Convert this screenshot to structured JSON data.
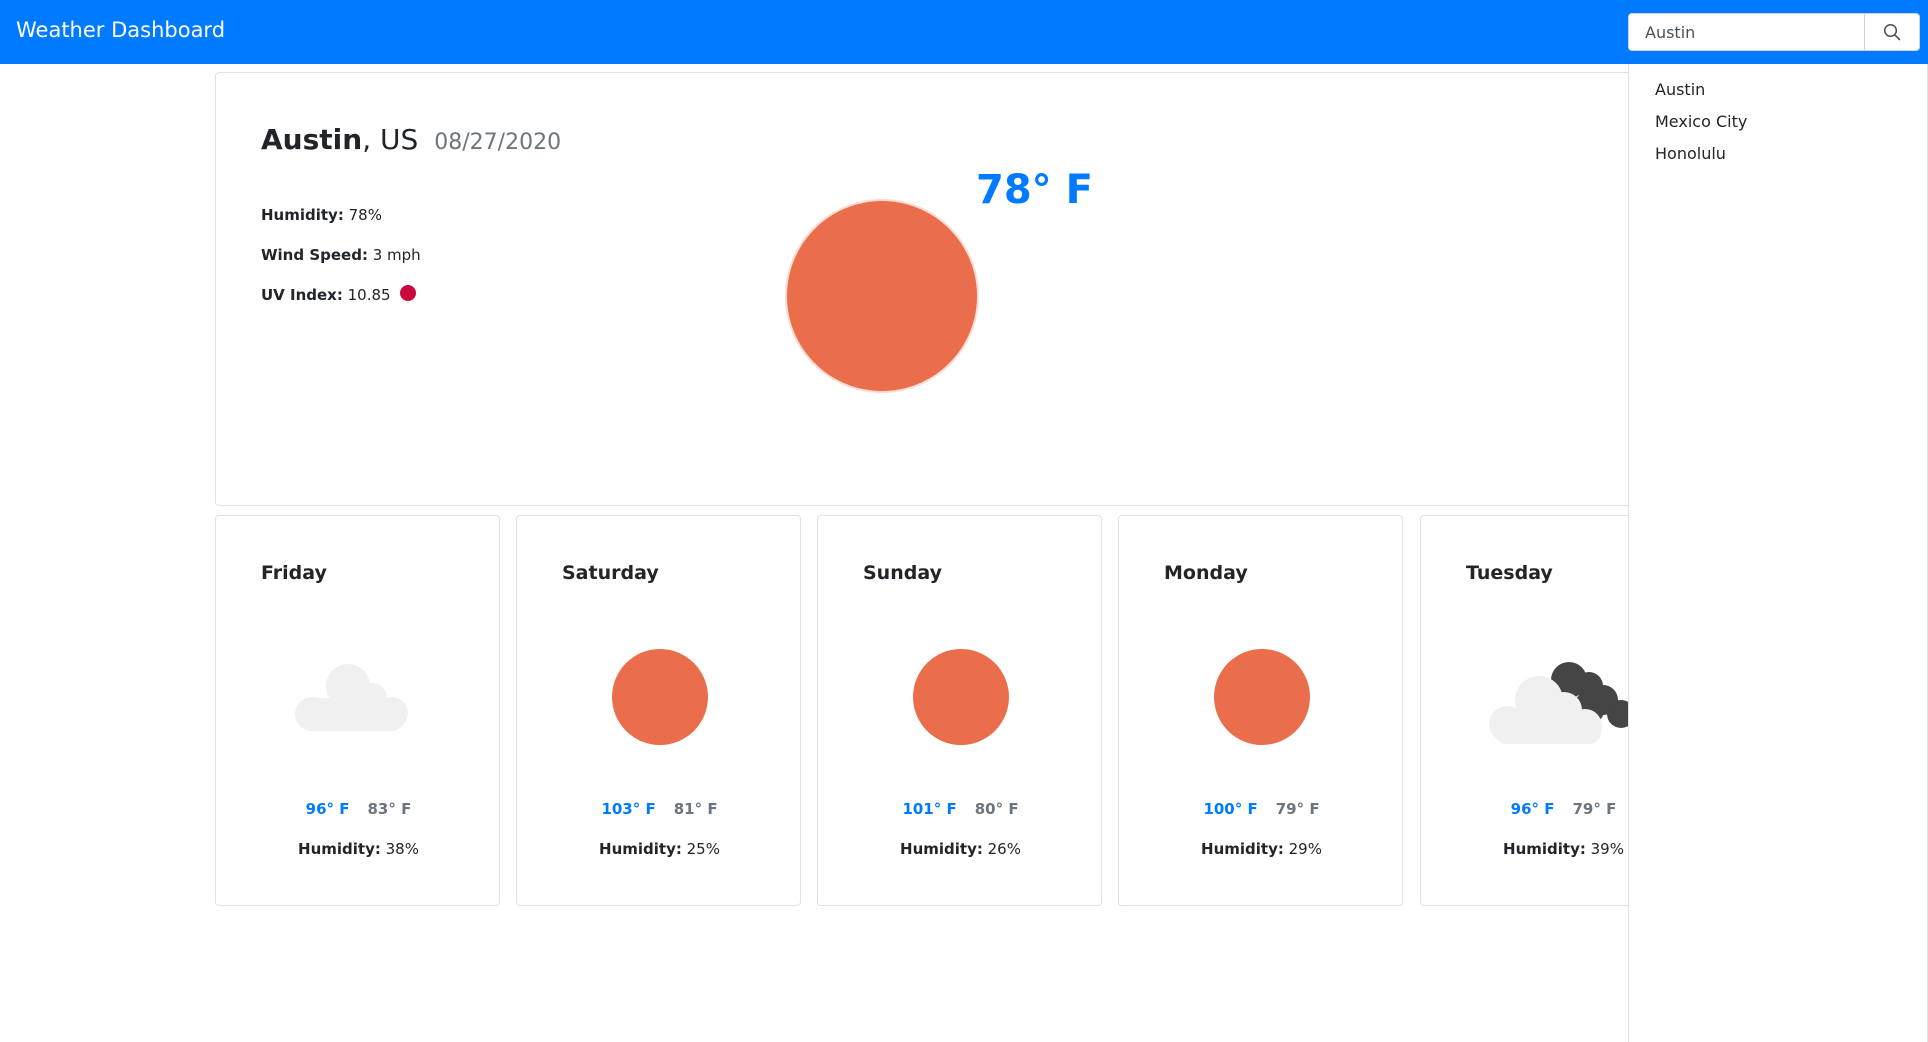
{
  "app": {
    "title": "Weather Dashboard"
  },
  "search": {
    "value": "Austin",
    "button_icon": "search-icon"
  },
  "history": [
    "Austin",
    "Mexico City",
    "Honolulu"
  ],
  "current": {
    "city": "Austin",
    "country": ", US",
    "date": "08/27/2020",
    "temperature": "78° F",
    "icon": "sun-icon",
    "humidity_label": "Humidity:",
    "humidity_value": "78%",
    "wind_label": "Wind Speed:",
    "wind_value": "3 mph",
    "uv_label": "UV Index:",
    "uv_value": "10.85",
    "uv_color": "#c80a3d"
  },
  "forecast": [
    {
      "day": "Friday",
      "icon": "cloud-icon",
      "high": "96° F",
      "low": "83° F",
      "humidity_label": "Humidity:",
      "humidity_value": "38%"
    },
    {
      "day": "Saturday",
      "icon": "sun-icon",
      "high": "103° F",
      "low": "81° F",
      "humidity_label": "Humidity:",
      "humidity_value": "25%"
    },
    {
      "day": "Sunday",
      "icon": "sun-icon",
      "high": "101° F",
      "low": "80° F",
      "humidity_label": "Humidity:",
      "humidity_value": "26%"
    },
    {
      "day": "Monday",
      "icon": "sun-icon",
      "high": "100° F",
      "low": "79° F",
      "humidity_label": "Humidity:",
      "humidity_value": "29%"
    },
    {
      "day": "Tuesday",
      "icon": "cloudy-icon",
      "high": "96° F",
      "low": "79° F",
      "humidity_label": "Humidity:",
      "humidity_value": "39%"
    }
  ],
  "colors": {
    "brand": "#007bff",
    "sun": "#ea6e4b",
    "low_temp": "#6c757d",
    "cloud_light": "#f0f0f0",
    "cloud_dark": "#454545"
  }
}
